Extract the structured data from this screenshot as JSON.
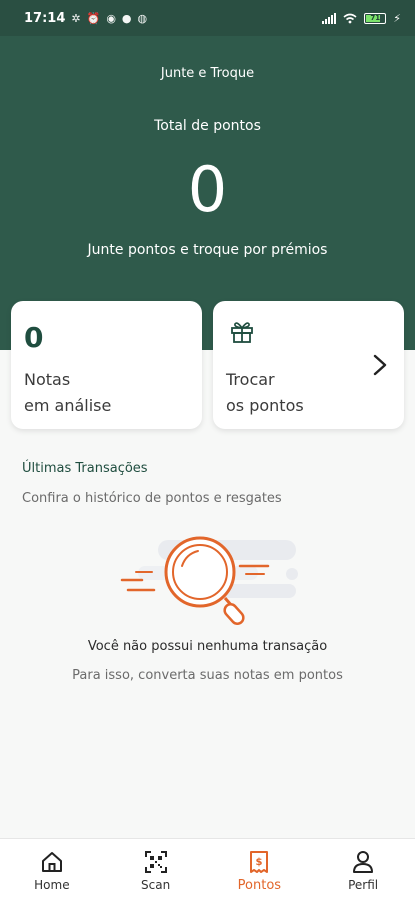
{
  "status_bar": {
    "time": "17:14",
    "battery": "71"
  },
  "header": {
    "app_title": "Junte e Troque",
    "points_label": "Total de pontos",
    "points_value": "0",
    "points_subtitle": "Junte pontos e troque por prémios"
  },
  "cards": {
    "notes_count": "0",
    "notes_line1": "Notas",
    "notes_line2": "em análise",
    "exchange_line1": "Trocar",
    "exchange_line2": "os pontos"
  },
  "transactions": {
    "title": "Últimas Transações",
    "subtitle": "Confira o histórico de pontos e resgates",
    "empty_title": "Você não possui nenhuma transação",
    "empty_subtitle": "Para isso, converta suas notas em pontos"
  },
  "bottom_nav": {
    "items": [
      {
        "label": "Home",
        "icon": "home-icon"
      },
      {
        "label": "Scan",
        "icon": "qr-scan-icon"
      },
      {
        "label": "Pontos",
        "icon": "points-receipt-icon"
      },
      {
        "label": "Perfil",
        "icon": "profile-icon"
      }
    ],
    "active_index": 2
  },
  "colors": {
    "header_green": "#2f5a4b",
    "accent_orange": "#e2662b",
    "dark_green_text": "#1f4d3f"
  }
}
